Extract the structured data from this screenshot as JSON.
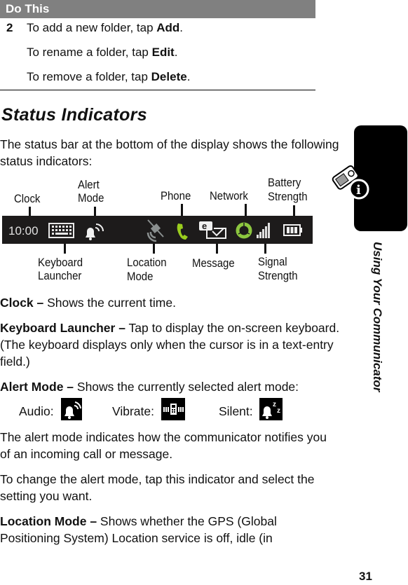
{
  "do_this": {
    "header": "Do This",
    "step_number": "2",
    "lines": [
      {
        "text": "To add a new folder, tap ",
        "bold": "Add",
        "end": "."
      },
      {
        "text": "To rename a folder, tap ",
        "bold": "Edit",
        "end": "."
      },
      {
        "text": "To remove a folder, tap ",
        "bold": "Delete",
        "end": "."
      }
    ]
  },
  "section_title": "Status Indicators",
  "intro": "The status bar at the bottom of the display shows the following status indicators:",
  "diagram": {
    "top_labels": {
      "clock": "Clock",
      "alert_mode": [
        "Alert",
        "Mode"
      ],
      "phone": "Phone",
      "network": "Network",
      "battery": [
        "Battery",
        "Strength"
      ]
    },
    "bottom_labels": {
      "keyboard": [
        "Keyboard",
        "Launcher"
      ],
      "location": [
        "Location",
        "Mode"
      ],
      "message": "Message",
      "signal": [
        "Signal",
        "Strength"
      ]
    },
    "status_bar": {
      "clock_text": "10:00",
      "message_badge": "e",
      "colors": {
        "bar": "#1d1b1b",
        "phone": "#9acd1e",
        "network": "#8cc63f",
        "location": "#8a8f8f",
        "white": "#e8e8e8"
      }
    }
  },
  "descriptions": {
    "clock": {
      "term": "Clock –",
      "text": " Shows the current time."
    },
    "keyboard": {
      "term": "Keyboard Launcher –",
      "text": " Tap to display the on-screen keyboard. (The keyboard displays only when the cursor is in a text-entry field.)"
    },
    "alert": {
      "term": "Alert Mode –",
      "text": " Shows the currently selected alert mode:"
    },
    "alert_modes": [
      {
        "label": "Audio:",
        "icon": "bell-audio-icon"
      },
      {
        "label": "Vibrate:",
        "icon": "vibrate-icon"
      },
      {
        "label": "Silent:",
        "icon": "bell-silent-icon"
      }
    ],
    "alert_note": "The alert mode indicates how the communicator notifies you of an incoming call or message.",
    "alert_change": "To change the alert mode, tap this indicator and select the setting you want.",
    "location": {
      "term": "Location Mode –",
      "text": " Shows whether the GPS (Global Positioning System) Location service is off, idle (in"
    }
  },
  "sidebar": {
    "section": "Using Your Communicator"
  },
  "page_number": "31"
}
